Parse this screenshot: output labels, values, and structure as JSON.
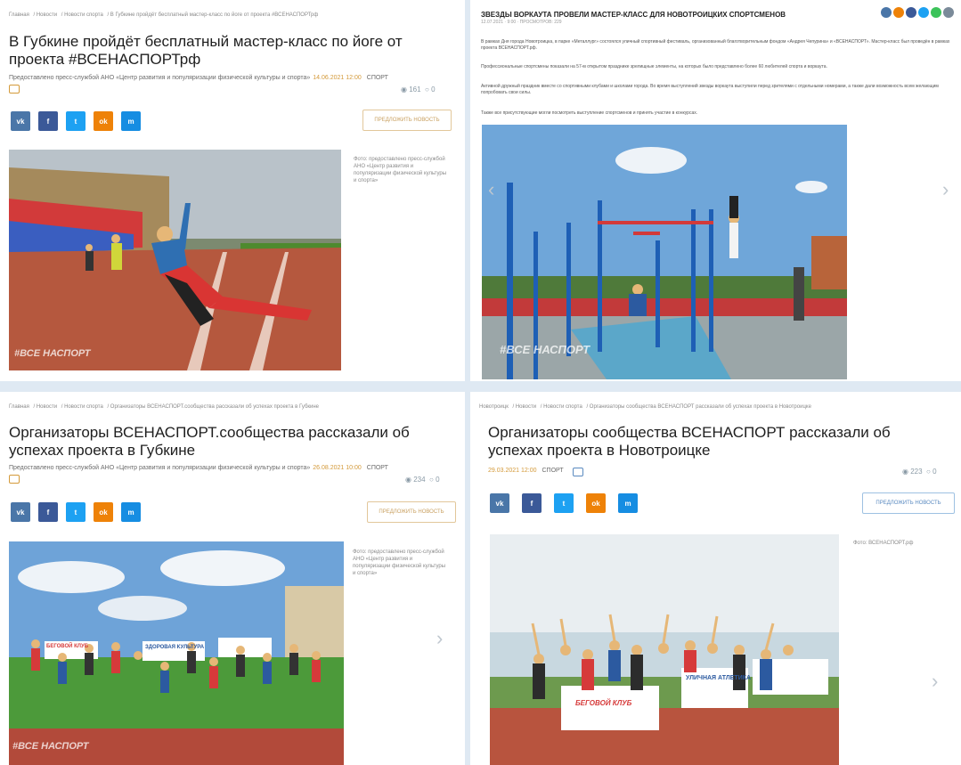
{
  "p1": {
    "breadcrumb": [
      "Главная",
      "/ Новости",
      "/ Новости спорта",
      "/ В Губкине пройдёт бесплатный мастер-класс по йоге от проекта #ВСЕНАСПОРТрф"
    ],
    "title": "В Губкине пройдёт бесплатный мастер-класс по йоге от проекта #ВСЕНАСПОРТрф",
    "source": "Предоставлено пресс-службой АНО «Центр развития и популяризации физической культуры и спорта»",
    "date": "14.06.2021 12:00",
    "tag": "СПОРТ",
    "views": "161",
    "comments": "0",
    "suggest": "ПРЕДЛОЖИТЬ НОВОСТЬ",
    "credit": "Фото: предоставлено пресс-службой АНО «Центр развития и популяризации физической культуры и спорта»",
    "watermark": "#ВСЕ НАСПОРТ"
  },
  "p2": {
    "title": "ЗВЕЗДЫ ВОРКАУТА ПРОВЕЛИ МАСТЕР-КЛАСС ДЛЯ НОВОТРОИЦКИХ СПОРТСМЕНОВ",
    "sub": "12.07.2021 · 9:00 · ПРОСМОТРОВ: 229",
    "para1": "В рамках Дня города Новотроицка, в парке «Металлург» состоялся уличный спортивный фестиваль, организованный благотворительным фондом «Андрея Чепурина» и «ВСЕНАСПОРТ». Мастер-класс был проведён в рамках проекта ВСЕНАСПОРТ.рф.",
    "para2": "Профессиональные спортсмены показали на 57-м открытом празднике зрелищные элементы, на которых было представлено более 60 любителей спорта и воркаута.",
    "para3": "Активной дружный праздник вместе со спортивными клубами и школами города. Во время выступлений звезды воркаута выступили перед зрителями с отдельными номерами, а также дали возможность всем желающим попробовать свои силы.",
    "para4": "Также все присутствующие могли посмотреть выступление спортсменов и принять участие в конкурсах.",
    "watermark": "#ВСЕ НАСПОРТ"
  },
  "p3": {
    "breadcrumb": [
      "Главная",
      "/ Новости",
      "/ Новости спорта",
      "/ Организаторы ВСЕНАСПОРТ.сообщества рассказали об успехах проекта в Губкине"
    ],
    "title": "Организаторы ВСЕНАСПОРТ.сообщества рассказали об успехах проекта в Губкине",
    "source": "Предоставлено пресс-службой АНО «Центр развития и популяризации физической культуры и спорта»",
    "date": "26.08.2021 10:00",
    "tag": "СПОРТ",
    "views": "234",
    "comments": "0",
    "suggest": "ПРЕДЛОЖИТЬ НОВОСТЬ",
    "credit": "Фото: предоставлено пресс-службой АНО «Центр развития и популяризации физической культуры и спорта»",
    "watermark": "#ВСЕ НАСПОРТ",
    "banner1": "БЕГОВОЙ КЛУБ",
    "banner2": "ЗДОРОВАЯ КУЛЬТУРА"
  },
  "p4": {
    "breadcrumb": [
      "Новотроицк",
      "/ Новости",
      "/ Новости спорта",
      "/ Организаторы сообщества ВСЕНАСПОРТ рассказали об успехах проекта в Новотроицке"
    ],
    "title": "Организаторы сообщества ВСЕНАСПОРТ рассказали об успехах проекта в Новотроицке",
    "date": "29.03.2021 12:00",
    "tag": "СПОРТ",
    "views": "223",
    "comments": "0",
    "suggest": "ПРЕДЛОЖИТЬ НОВОСТЬ",
    "credit": "Фото: ВСЕНАСПОРТ.рф",
    "banner1": "БЕГОВОЙ КЛУБ",
    "banner2": "УЛИЧНАЯ АТЛЕТИКА"
  },
  "social": [
    "vk",
    "f",
    "t",
    "ok",
    "m"
  ],
  "colors": {
    "vk": "#4a76a8",
    "fb": "#3b5998",
    "tw": "#1da1f2",
    "ok": "#ee8208",
    "mail": "#168de2",
    "accent": "#d49a3a"
  }
}
